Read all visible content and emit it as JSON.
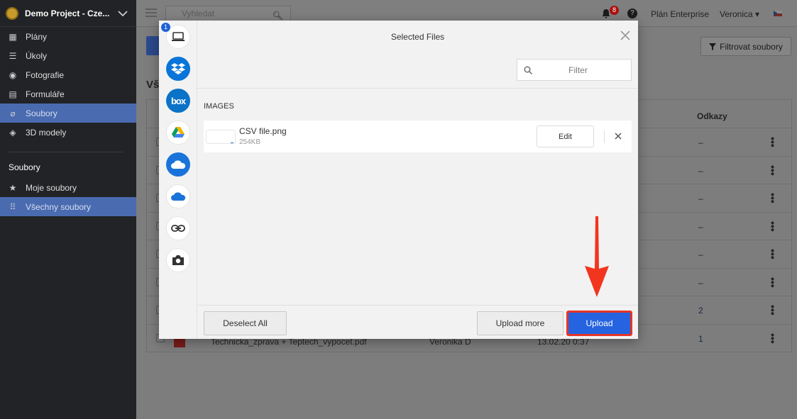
{
  "sidebar": {
    "project_name": "Demo Project - Cze...",
    "nav": [
      {
        "label": "Plány",
        "icon": "plans-icon",
        "glyph": "▦"
      },
      {
        "label": "Úkoly",
        "icon": "list-icon",
        "glyph": "☰"
      },
      {
        "label": "Fotografie",
        "icon": "camera-icon",
        "glyph": "◉"
      },
      {
        "label": "Formuláře",
        "icon": "clipboard-icon",
        "glyph": "▤"
      },
      {
        "label": "Soubory",
        "icon": "paperclip-icon",
        "glyph": "⌀",
        "active": true
      },
      {
        "label": "3D modely",
        "icon": "cube-icon",
        "glyph": "◈"
      }
    ],
    "section_title": "Soubory",
    "sub": [
      {
        "label": "Moje soubory",
        "icon": "star-icon",
        "glyph": "★"
      },
      {
        "label": "Všechny soubory",
        "icon": "grid-icon",
        "glyph": "⠿",
        "active": true
      }
    ]
  },
  "topbar": {
    "search_placeholder": "Vyhledat",
    "notifications": "8",
    "help": "?",
    "plan": "Plán Enterprise",
    "user": "Veronica ▾"
  },
  "page": {
    "filter_label": "Filtrovat soubory",
    "section_heading": "Vš",
    "col_links": "Odkazy",
    "rows": [
      {
        "links": "–"
      },
      {
        "links": "–"
      },
      {
        "links": "–"
      },
      {
        "links": "–"
      },
      {
        "links": "–"
      },
      {
        "links": "–"
      },
      {
        "links": "2"
      },
      {
        "links": "1",
        "name": "Technicka_zprava + Teptech_vypocet.pdf",
        "owner": "Veronika D",
        "date": "13.02.20 0:37"
      }
    ]
  },
  "modal": {
    "title": "Selected Files",
    "filter_placeholder": "Filter",
    "selected_count": "1",
    "sources": [
      "computer-icon",
      "dropbox-icon",
      "box-icon",
      "google-drive-icon",
      "onedrive-icon",
      "onedrive-business-icon",
      "link-icon",
      "camera-icon"
    ],
    "box_label": "box",
    "category": "IMAGES",
    "file": {
      "name": "CSV file.png",
      "size": "254KB"
    },
    "edit_label": "Edit",
    "deselect_label": "Deselect All",
    "upload_more_label": "Upload more",
    "upload_label": "Upload"
  },
  "colors": {
    "accent": "#2563e0",
    "highlight": "#e5352a",
    "sidebar": "#222326",
    "sidebar_active": "#4a6bb0"
  }
}
